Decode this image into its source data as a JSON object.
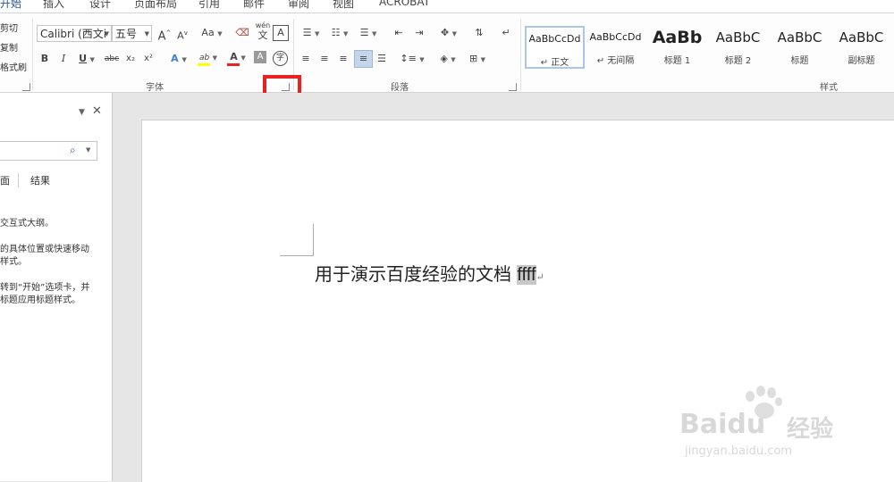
{
  "tabs": [
    {
      "label": "开始",
      "active": true
    },
    {
      "label": "插入"
    },
    {
      "label": "设计"
    },
    {
      "label": "页面布局"
    },
    {
      "label": "引用"
    },
    {
      "label": "邮件"
    },
    {
      "label": "审阅"
    },
    {
      "label": "视图"
    },
    {
      "label": "ACROBAT"
    }
  ],
  "clipboard": {
    "cut": "剪切",
    "copy": "复制",
    "format_painter": "格式刷"
  },
  "font_group": {
    "label": "字体",
    "font_name": "Calibri (西文i",
    "font_size": "五号",
    "grow": "A",
    "shrink": "A",
    "change_case": "Aa",
    "wen": "wén",
    "wen_char": "文",
    "border_char": "A",
    "bold": "B",
    "italic": "I",
    "underline": "U",
    "strikethrough": "abc",
    "subscript": "x₂",
    "superscript": "x²",
    "text_effect": "A",
    "highlight": "ab",
    "font_color": "A",
    "shading": "A",
    "enclose": "字"
  },
  "paragraph_group": {
    "label": "段落"
  },
  "styles_group": {
    "label": "样式",
    "items": [
      {
        "sample": "AaBbCcDd",
        "name": "↵ 正文"
      },
      {
        "sample": "AaBbCcDd",
        "name": "↵ 无间隔"
      },
      {
        "sample": "AaBb",
        "name": "标题 1"
      },
      {
        "sample": "AaBbC",
        "name": "标题 2"
      },
      {
        "sample": "AaBbC",
        "name": "标题"
      },
      {
        "sample": "AaBbC",
        "name": "副标题"
      }
    ]
  },
  "nav_pane": {
    "close": "✕",
    "dropdown": "▼",
    "tab_pages": "面",
    "tab_results": "结果",
    "help": [
      "交互式大纲。",
      "的具体位置或快速移动",
      "样式。",
      "转到“开始”选项卡，并",
      "标题应用标题样式。"
    ]
  },
  "document": {
    "text": "用于演示百度经验的文档 ",
    "selected": "ffff",
    "para_mark": "↵"
  },
  "watermark": {
    "brand": "Bai",
    "brand_rest": "du",
    "jingyan": "经验",
    "url": "jingyan.baidu.com"
  },
  "colors": {
    "accent": "#2b579a",
    "highlight_box": "#e8221f",
    "font_color_bar": "#e8221f",
    "highlight_bar": "#ffff00"
  }
}
